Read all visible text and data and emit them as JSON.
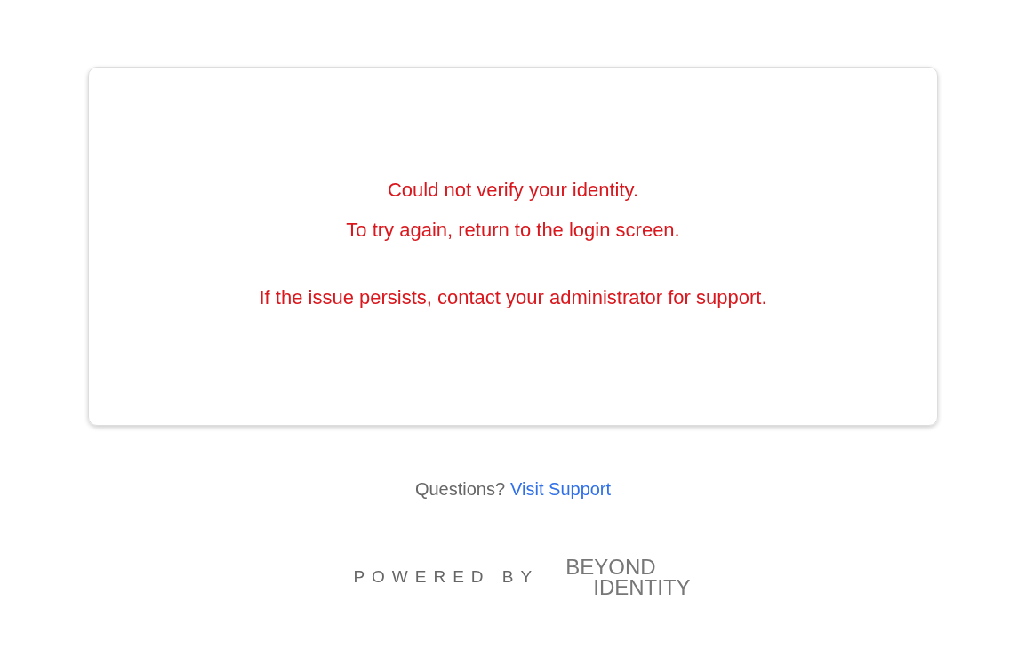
{
  "error_card": {
    "lines": [
      "Could not verify your identity.",
      "To try again, return to the login screen."
    ],
    "note": "If the issue persists, contact your administrator for support."
  },
  "support": {
    "prompt": "Questions?",
    "link": "Visit Support"
  },
  "footer": {
    "powered_by": "POWERED BY",
    "logo_lines": [
      "BEYOND",
      "IDENTITY"
    ]
  }
}
